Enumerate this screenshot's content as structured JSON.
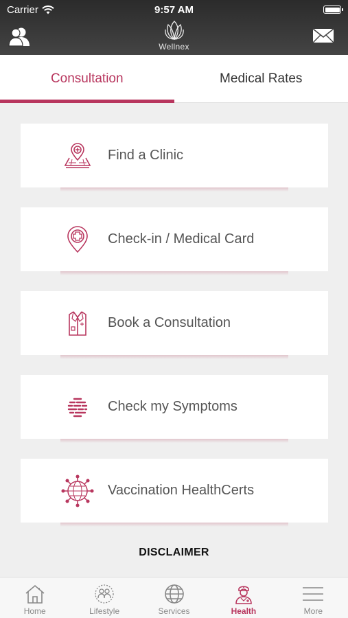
{
  "status_bar": {
    "carrier": "Carrier",
    "time": "9:57 AM"
  },
  "header": {
    "logo_text": "Wellnex"
  },
  "tabs": [
    {
      "label": "Consultation",
      "active": true
    },
    {
      "label": "Medical Rates",
      "active": false
    }
  ],
  "cards": [
    {
      "label": "Find a Clinic",
      "icon": "clinic-map-pin-icon"
    },
    {
      "label": "Check-in / Medical Card",
      "icon": "location-cross-icon"
    },
    {
      "label": "Book a Consultation",
      "icon": "doctor-coat-icon"
    },
    {
      "label": "Check my Symptoms",
      "icon": "symptoms-icon"
    },
    {
      "label": "Vaccination HealthCerts",
      "icon": "virus-globe-icon"
    }
  ],
  "disclaimer": "DISCLAIMER",
  "bottom_nav": [
    {
      "label": "Home",
      "icon": "home-icon",
      "active": false
    },
    {
      "label": "Lifestyle",
      "icon": "lifestyle-icon",
      "active": false
    },
    {
      "label": "Services",
      "icon": "globe-icon",
      "active": false
    },
    {
      "label": "Health",
      "icon": "nurse-icon",
      "active": true
    },
    {
      "label": "More",
      "icon": "hamburger-icon",
      "active": false
    }
  ],
  "colors": {
    "accent": "#b8365e",
    "background": "#efefef",
    "header": "#333333"
  }
}
